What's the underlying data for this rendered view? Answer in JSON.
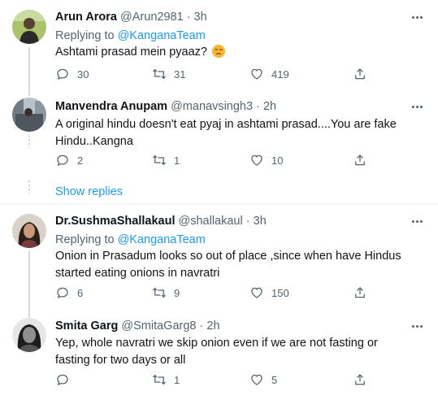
{
  "tweets": [
    {
      "name": "Arun Arora",
      "handle": "@Arun2981",
      "sep": "·",
      "time": "3h",
      "replying_prefix": "Replying to",
      "replying_to": "@KanganaTeam",
      "text": "Ashtami prasad mein pyaaz?",
      "emoji": "unamused-face-emoji",
      "replies": "30",
      "retweets": "31",
      "likes": "419"
    },
    {
      "name": "Manvendra Anupam",
      "handle": "@manavsingh3",
      "sep": "·",
      "time": "2h",
      "text": "A original hindu doesn't eat pyaj in ashtami prasad....You are fake Hindu..Kangna",
      "replies": "2",
      "retweets": "1",
      "likes": "10"
    },
    {
      "name": "Dr.SushmaShallakaul",
      "handle": "@shallakaul",
      "sep": "·",
      "time": "3h",
      "replying_prefix": "Replying to",
      "replying_to": "@KanganaTeam",
      "text": "Onion in Prasadum looks so out of place ,since when have Hindus started eating onions in navratri",
      "replies": "6",
      "retweets": "9",
      "likes": "150"
    },
    {
      "name": "Smita Garg",
      "handle": "@SmitaGarg8",
      "sep": "·",
      "time": "2h",
      "text": "Yep, whole navratri we skip onion even if we are not fasting or fasting for two days or all",
      "replies": "",
      "retweets": "1",
      "likes": "5"
    }
  ],
  "show_replies": "Show replies",
  "colors": {
    "link": "#1d9bf0",
    "secondary_text": "#536471",
    "thread_line": "#cfd9de"
  },
  "icons": [
    "reply-icon",
    "retweet-icon",
    "like-icon",
    "share-icon",
    "more-icon"
  ]
}
